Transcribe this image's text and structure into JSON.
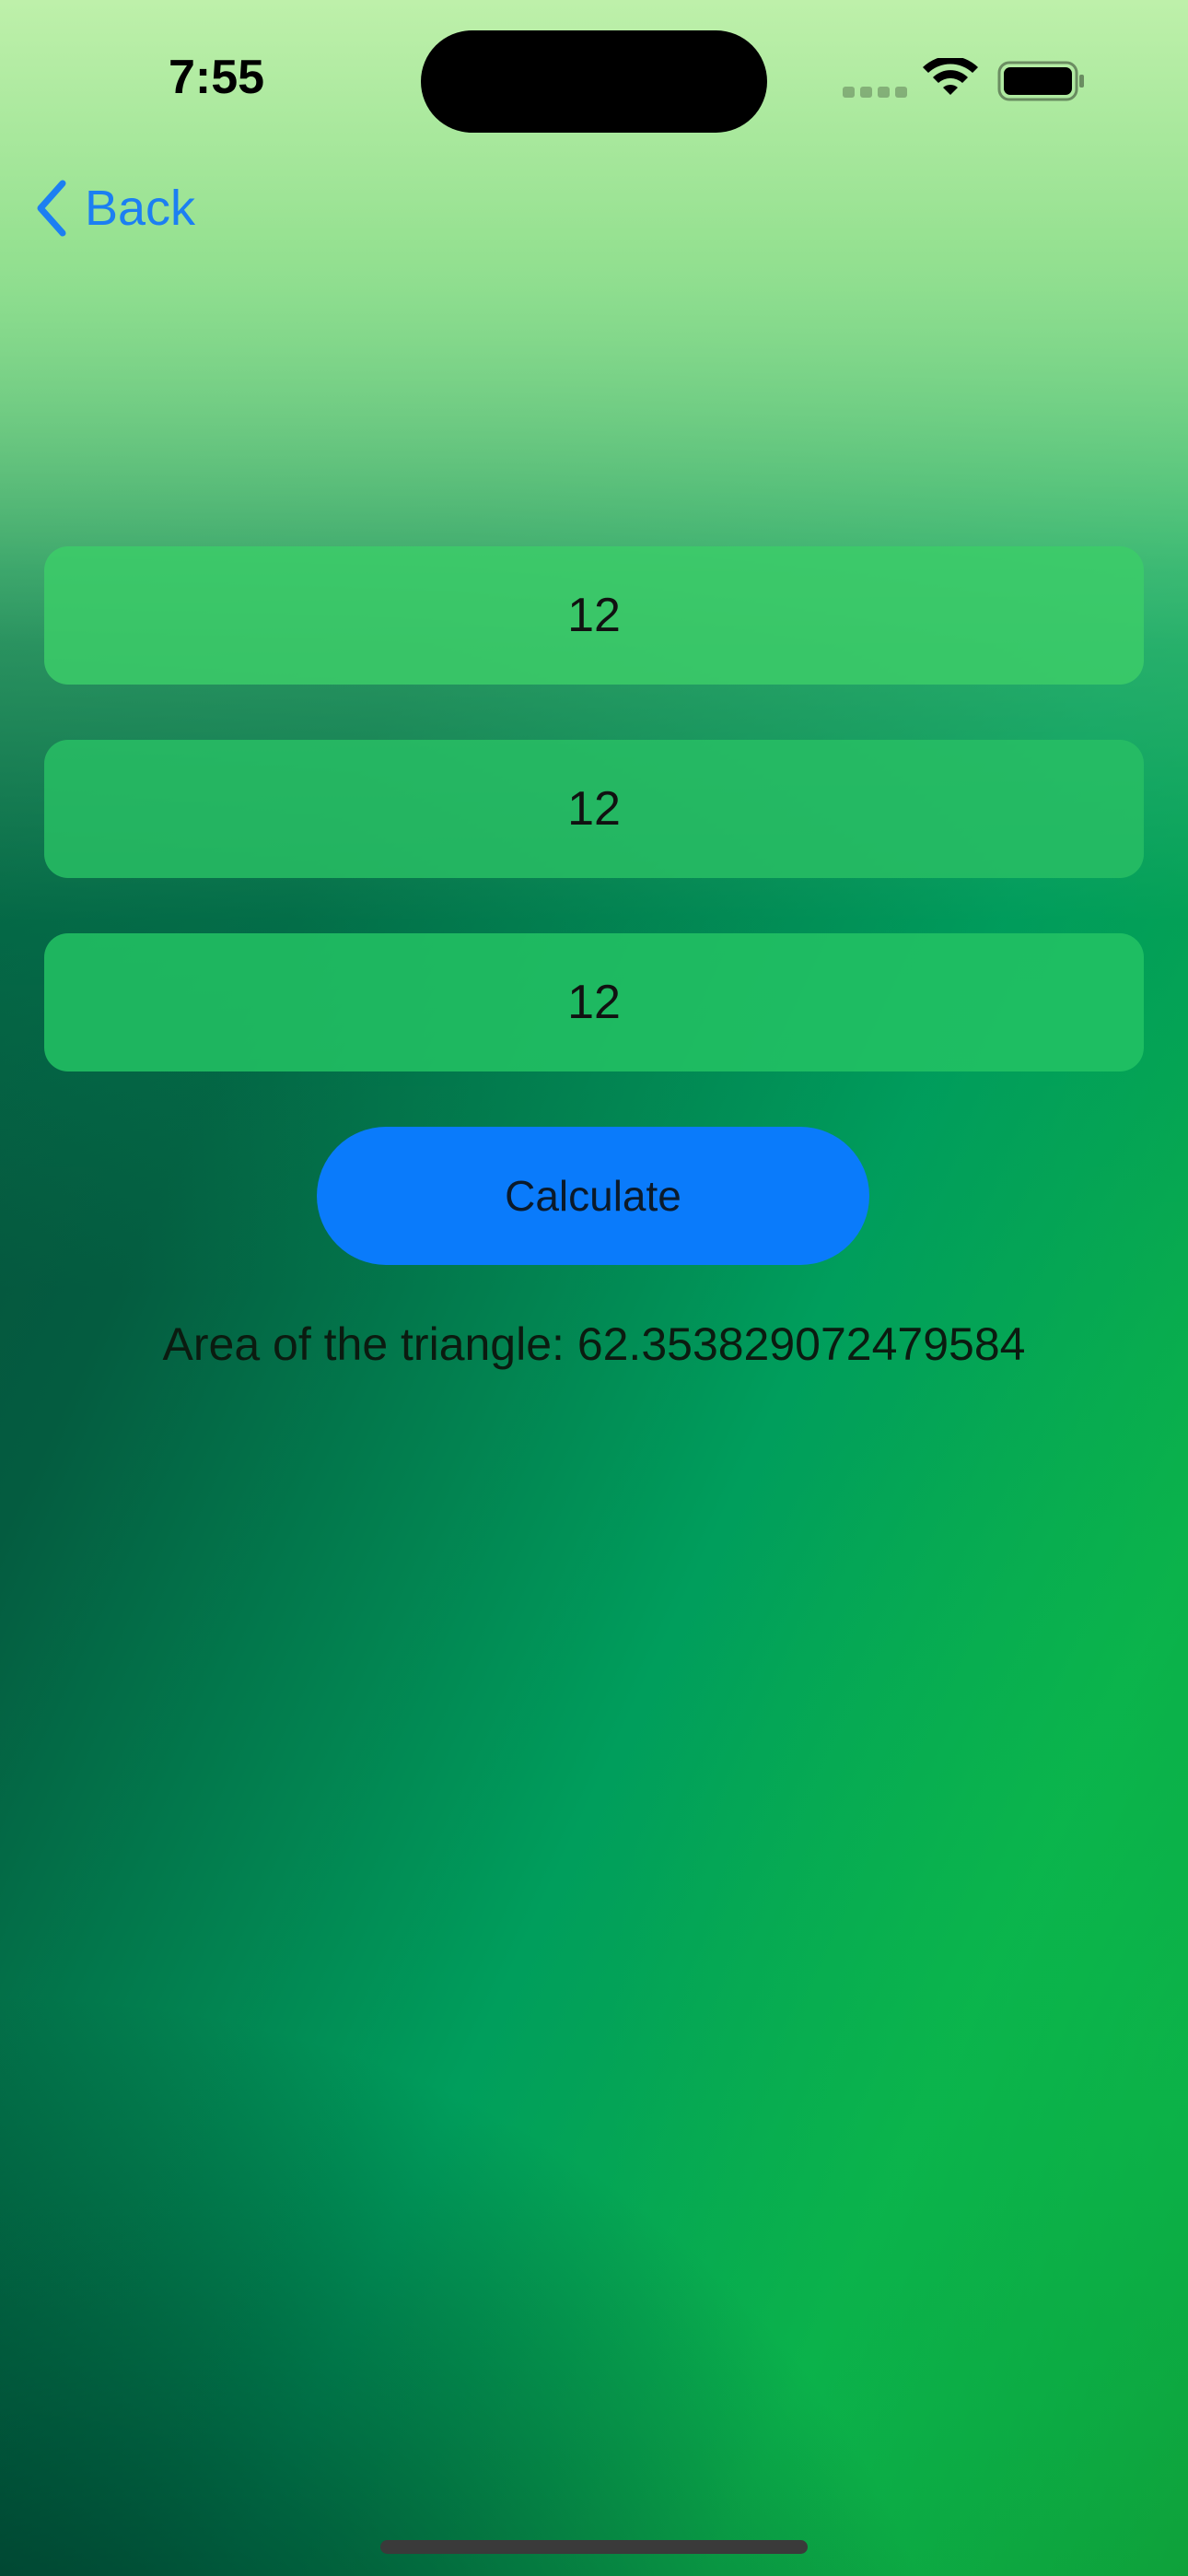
{
  "status_bar": {
    "time": "7:55"
  },
  "nav": {
    "back_label": "Back"
  },
  "fields": [
    {
      "value": "12"
    },
    {
      "value": "12"
    },
    {
      "value": "12"
    }
  ],
  "calculate_button": {
    "label": "Calculate"
  },
  "result": {
    "text": "Area of the triangle: 62.353829072479584"
  },
  "colors": {
    "accent": "#0a7bfb",
    "link": "#1c7ff2"
  },
  "icons": {
    "back": "chevron-left-icon",
    "wifi": "wifi-icon",
    "battery": "battery-icon",
    "signal": "cellular-signal-icon"
  }
}
